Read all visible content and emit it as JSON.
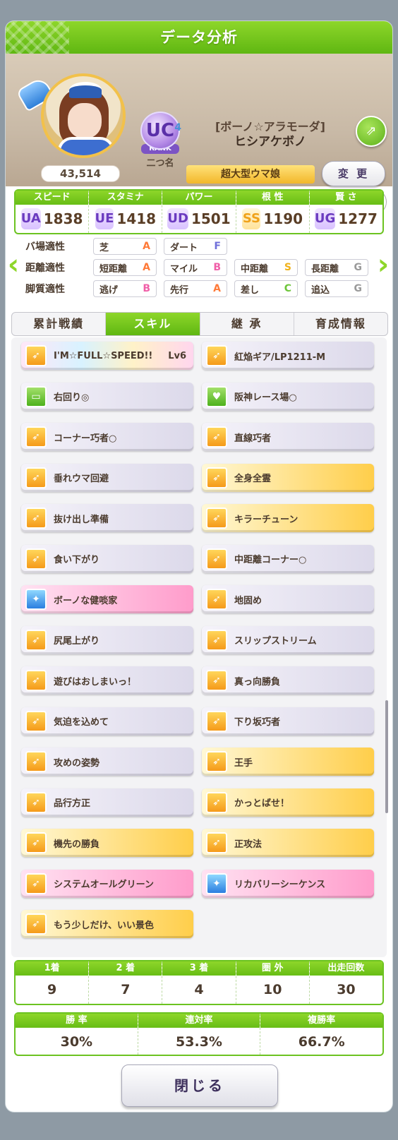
{
  "header": {
    "title": "データ分析"
  },
  "profile": {
    "fans": "43,514",
    "rank_letters": "UC",
    "rank_sub": "4",
    "rank_word": "RANK",
    "rank_title": "二つ名",
    "epithet": "[ボーノ☆アラモーダ]",
    "name": "ヒシアケボノ",
    "nickname": "超大型ウマ娘",
    "change_label": "変 更",
    "comment": "－"
  },
  "stats": [
    {
      "label": "スピード",
      "grade": "UA",
      "value": "1838"
    },
    {
      "label": "スタミナ",
      "grade": "UE",
      "value": "1418"
    },
    {
      "label": "パワー",
      "grade": "UD",
      "value": "1501"
    },
    {
      "label": "根 性",
      "grade": "SS",
      "value": "1190"
    },
    {
      "label": "賢 さ",
      "grade": "UG",
      "value": "1277"
    }
  ],
  "aptitude": {
    "track": {
      "label": "バ場適性",
      "cells": [
        {
          "name": "芝",
          "grade": "A"
        },
        {
          "name": "ダート",
          "grade": "F"
        }
      ]
    },
    "distance": {
      "label": "距離適性",
      "cells": [
        {
          "name": "短距離",
          "grade": "A"
        },
        {
          "name": "マイル",
          "grade": "B"
        },
        {
          "name": "中距離",
          "grade": "S"
        },
        {
          "name": "長距離",
          "grade": "G"
        }
      ]
    },
    "style": {
      "label": "脚質適性",
      "cells": [
        {
          "name": "逃げ",
          "grade": "B"
        },
        {
          "name": "先行",
          "grade": "A"
        },
        {
          "name": "差し",
          "grade": "C"
        },
        {
          "name": "追込",
          "grade": "G"
        }
      ]
    }
  },
  "tabs": [
    "累計戦績",
    "スキル",
    "継 承",
    "育成情報"
  ],
  "skills": [
    {
      "name": "I'M☆FULL☆SPEED!!",
      "level": "Lv6",
      "type": "unique",
      "icon": "speed-icon"
    },
    {
      "name": "紅焔ギア/LP1211-M",
      "type": "normal",
      "icon": "speed-icon"
    },
    {
      "name": "右回り◎",
      "type": "normal",
      "icon": "course-icon"
    },
    {
      "name": "阪神レース場○",
      "type": "normal",
      "icon": "heart-icon"
    },
    {
      "name": "コーナー巧者○",
      "type": "normal",
      "icon": "speed-icon"
    },
    {
      "name": "直線巧者",
      "type": "normal",
      "icon": "speed-icon"
    },
    {
      "name": "垂れウマ回避",
      "type": "normal",
      "icon": "speed-icon"
    },
    {
      "name": "全身全霊",
      "type": "gold",
      "icon": "speed-icon"
    },
    {
      "name": "抜け出し準備",
      "type": "normal",
      "icon": "speed-icon"
    },
    {
      "name": "キラーチューン",
      "type": "gold",
      "icon": "speed-icon"
    },
    {
      "name": "食い下がり",
      "type": "normal",
      "icon": "speed-icon"
    },
    {
      "name": "中距離コーナー○",
      "type": "normal",
      "icon": "speed-icon"
    },
    {
      "name": "ボーノな健啖家",
      "type": "pink",
      "icon": "recovery-icon"
    },
    {
      "name": "地固め",
      "type": "normal",
      "icon": "speed-icon"
    },
    {
      "name": "尻尾上がり",
      "type": "normal",
      "icon": "speed-icon"
    },
    {
      "name": "スリップストリーム",
      "type": "normal",
      "icon": "speed-icon"
    },
    {
      "name": "遊びはおしまいっ！",
      "type": "normal",
      "icon": "speed-icon"
    },
    {
      "name": "真っ向勝負",
      "type": "normal",
      "icon": "speed-icon"
    },
    {
      "name": "気迫を込めて",
      "type": "normal",
      "icon": "speed-icon"
    },
    {
      "name": "下り坂巧者",
      "type": "normal",
      "icon": "speed-icon"
    },
    {
      "name": "攻めの姿勢",
      "type": "normal",
      "icon": "speed-icon"
    },
    {
      "name": "王手",
      "type": "gold",
      "icon": "speed-icon"
    },
    {
      "name": "品行方正",
      "type": "normal",
      "icon": "speed-icon"
    },
    {
      "name": "かっとばせ！",
      "type": "gold",
      "icon": "speed-icon"
    },
    {
      "name": "機先の勝負",
      "type": "gold",
      "icon": "speed-icon"
    },
    {
      "name": "正攻法",
      "type": "gold",
      "icon": "speed-icon"
    },
    {
      "name": "システムオールグリーン",
      "type": "pink",
      "icon": "speed-icon"
    },
    {
      "name": "リカバリーシーケンス",
      "type": "pink",
      "icon": "recovery-icon"
    },
    {
      "name": "もう少しだけ、いい景色",
      "type": "gold",
      "icon": "speed-icon"
    }
  ],
  "results": [
    {
      "label": "1着",
      "value": "9"
    },
    {
      "label": "2 着",
      "value": "7"
    },
    {
      "label": "3 着",
      "value": "4"
    },
    {
      "label": "圏 外",
      "value": "10"
    },
    {
      "label": "出走回数",
      "value": "30"
    }
  ],
  "rates": [
    {
      "label": "勝 率",
      "value": "30%"
    },
    {
      "label": "連対率",
      "value": "53.3%"
    },
    {
      "label": "複勝率",
      "value": "66.7%"
    }
  ],
  "footer": {
    "close_label": "閉じる"
  }
}
